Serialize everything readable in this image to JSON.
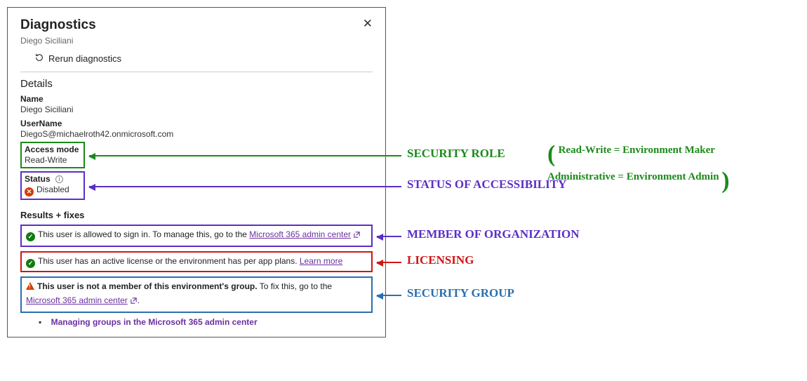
{
  "panel": {
    "title": "Diagnostics",
    "subtitle": "Diego Siciliani",
    "rerun_label": "Rerun diagnostics"
  },
  "details": {
    "heading": "Details",
    "name_label": "Name",
    "name_value": "Diego Siciliani",
    "username_label": "UserName",
    "username_value": "DiegoS@michaelroth42.onmicrosoft.com",
    "access_mode_label": "Access mode",
    "access_mode_value": "Read-Write",
    "status_label": "Status",
    "status_value": "Disabled"
  },
  "results": {
    "heading": "Results + fixes",
    "row1_a": "This user is allowed to sign in. To manage this, go to the ",
    "row1_link": "Microsoft 365 admin center",
    "row2_a": "This user has an active license or the environment has per app plans. ",
    "row2_link": "Learn more",
    "row3_bold": "This user is not a member of this environment's group.",
    "row3_a": " To fix this, go to the ",
    "row3_link": "Microsoft 365 admin center",
    "row3_period": ".",
    "bullet_link": "Managing groups in the Microsoft 365 admin center"
  },
  "annotations": {
    "security_role": "SECURITY ROLE",
    "paren_line1": "Read-Write = Environment Maker",
    "paren_line2": "Administrative = Environment Admin",
    "status_acc": "STATUS OF ACCESSIBILITY",
    "member_org": "MEMBER OF ORGANIZATION",
    "licensing": "LICENSING",
    "security_group": "SECURITY GROUP"
  },
  "colors": {
    "green": "#1a8a1a",
    "purple": "#5b2fc7",
    "red": "#d01616",
    "blue": "#2a6fae"
  }
}
